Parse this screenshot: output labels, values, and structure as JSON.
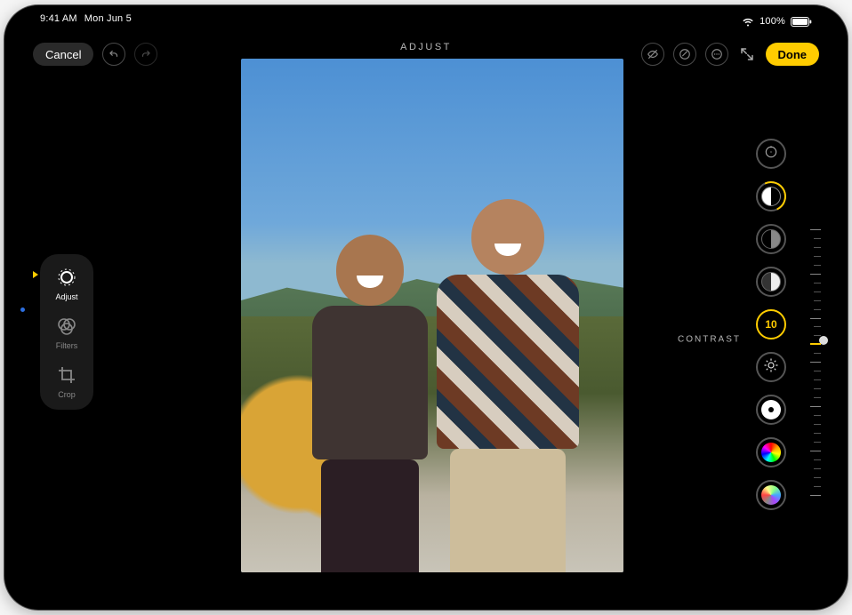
{
  "status": {
    "time": "9:41 AM",
    "date": "Mon Jun 5",
    "battery_pct": "100%"
  },
  "toolbar": {
    "cancel": "Cancel",
    "done": "Done",
    "mode_title": "ADJUST"
  },
  "left_modes": {
    "adjust": "Adjust",
    "filters": "Filters",
    "crop": "Crop"
  },
  "adjustments": {
    "active_label": "CONTRAST",
    "active_value": "10",
    "items": [
      {
        "id": "auto",
        "name": "auto"
      },
      {
        "id": "exposure",
        "name": "exposure"
      },
      {
        "id": "brilliance",
        "name": "brilliance"
      },
      {
        "id": "highlights",
        "name": "highlights"
      },
      {
        "id": "contrast",
        "name": "contrast"
      },
      {
        "id": "brightness",
        "name": "brightness"
      },
      {
        "id": "blackpoint",
        "name": "blackpoint"
      },
      {
        "id": "saturation",
        "name": "saturation"
      },
      {
        "id": "vibrance",
        "name": "vibrance"
      }
    ]
  }
}
